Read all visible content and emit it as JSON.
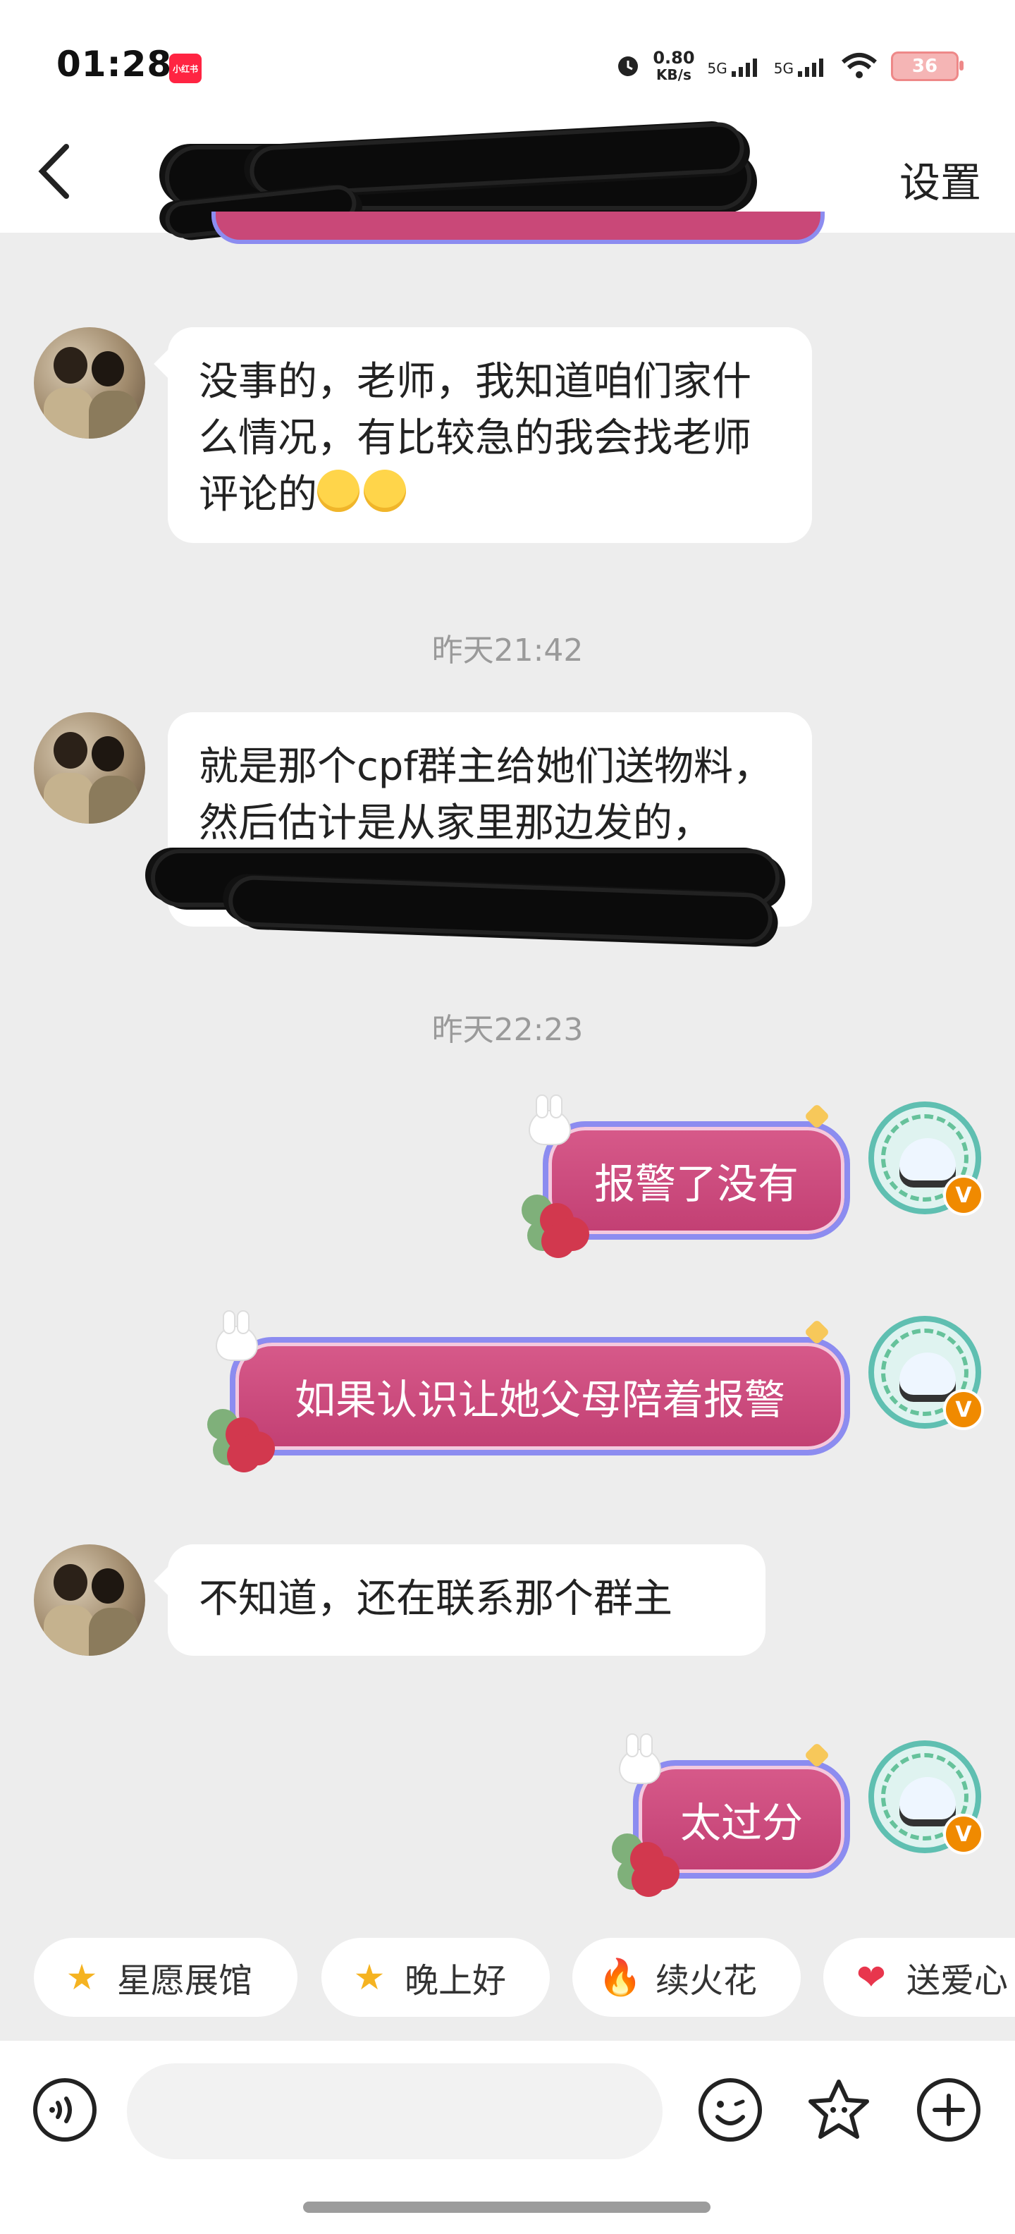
{
  "status_bar": {
    "time": "01:28",
    "app_chip": "小红书",
    "net_speed_value": "0.80",
    "net_speed_unit": "KB/s",
    "sig1": "5G",
    "sig2": "5G",
    "battery": "36"
  },
  "nav": {
    "title": "",
    "settings_label": "设置"
  },
  "messages": {
    "m1": {
      "text": "没事的，老师，我知道咱们家什么情况，有比较急的我会找老师评论的"
    },
    "ts1": "昨天21:42",
    "m2": {
      "text": "就是那个cpf群主给她们送物料，然后估计是从家里那边发的，"
    },
    "ts2": "昨天22:23",
    "m3": {
      "text": "报警了没有"
    },
    "m4": {
      "text": "如果认识让她父母陪着报警"
    },
    "m5": {
      "text": "不知道，还在联系那个群主"
    },
    "m6": {
      "text": "太过分"
    }
  },
  "badge_letter": "V",
  "quick_chips": [
    {
      "label": "星愿展馆",
      "icon": "star-icon",
      "glyph": "★",
      "color": "#f5b321"
    },
    {
      "label": "晚上好",
      "icon": "smiling-star-icon",
      "glyph": "★",
      "color": "#f5b321"
    },
    {
      "label": "续火花",
      "icon": "flame-icon",
      "glyph": "🔥",
      "color": "#f05a28"
    },
    {
      "label": "送爱心",
      "icon": "heart-icon",
      "glyph": "❤",
      "color": "#e8364d"
    }
  ]
}
